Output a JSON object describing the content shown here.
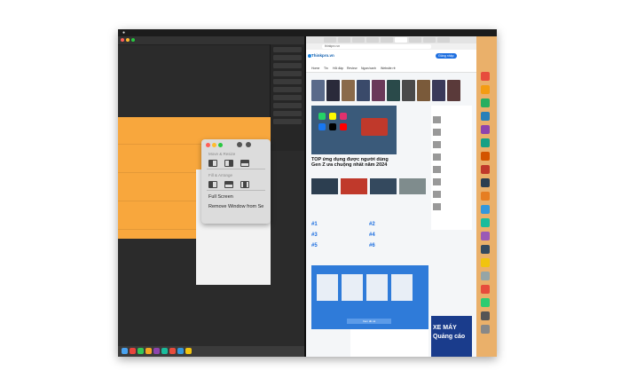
{
  "menubar": {
    "apple": "",
    "right": ""
  },
  "left_app": {
    "title": ""
  },
  "popup": {
    "move_resize_label": "Move & Resize",
    "fill_arrange_label": "Fill & Arrange",
    "full_screen_label": "Full Screen",
    "remove_window_label": "Remove Window from Se"
  },
  "browser": {
    "url": "thinkpro.vn",
    "logo": "Thinkpro.vn",
    "nav": [
      "Home",
      "Tin",
      "Hỏi đáp",
      "Review",
      "Ngon/xanh",
      "Website rẻ"
    ],
    "cta": "Đăng nhập",
    "featured_title": "TOP ứng dụng được người dùng Gen Z ưa chuộng nhất năm 2024",
    "list_numbers": [
      "#1",
      "#2",
      "#3",
      "#4",
      "#5",
      "#6"
    ],
    "ad_lines": [
      "XE MÁY",
      "Quảng cáo",
      ""
    ],
    "bluebox_cta": "Xem tất cả"
  },
  "colors": {
    "orange": "#f8a73d",
    "dark": "#2b2b2b",
    "blue": "#2f7bd9",
    "dock": "#eab06a"
  }
}
